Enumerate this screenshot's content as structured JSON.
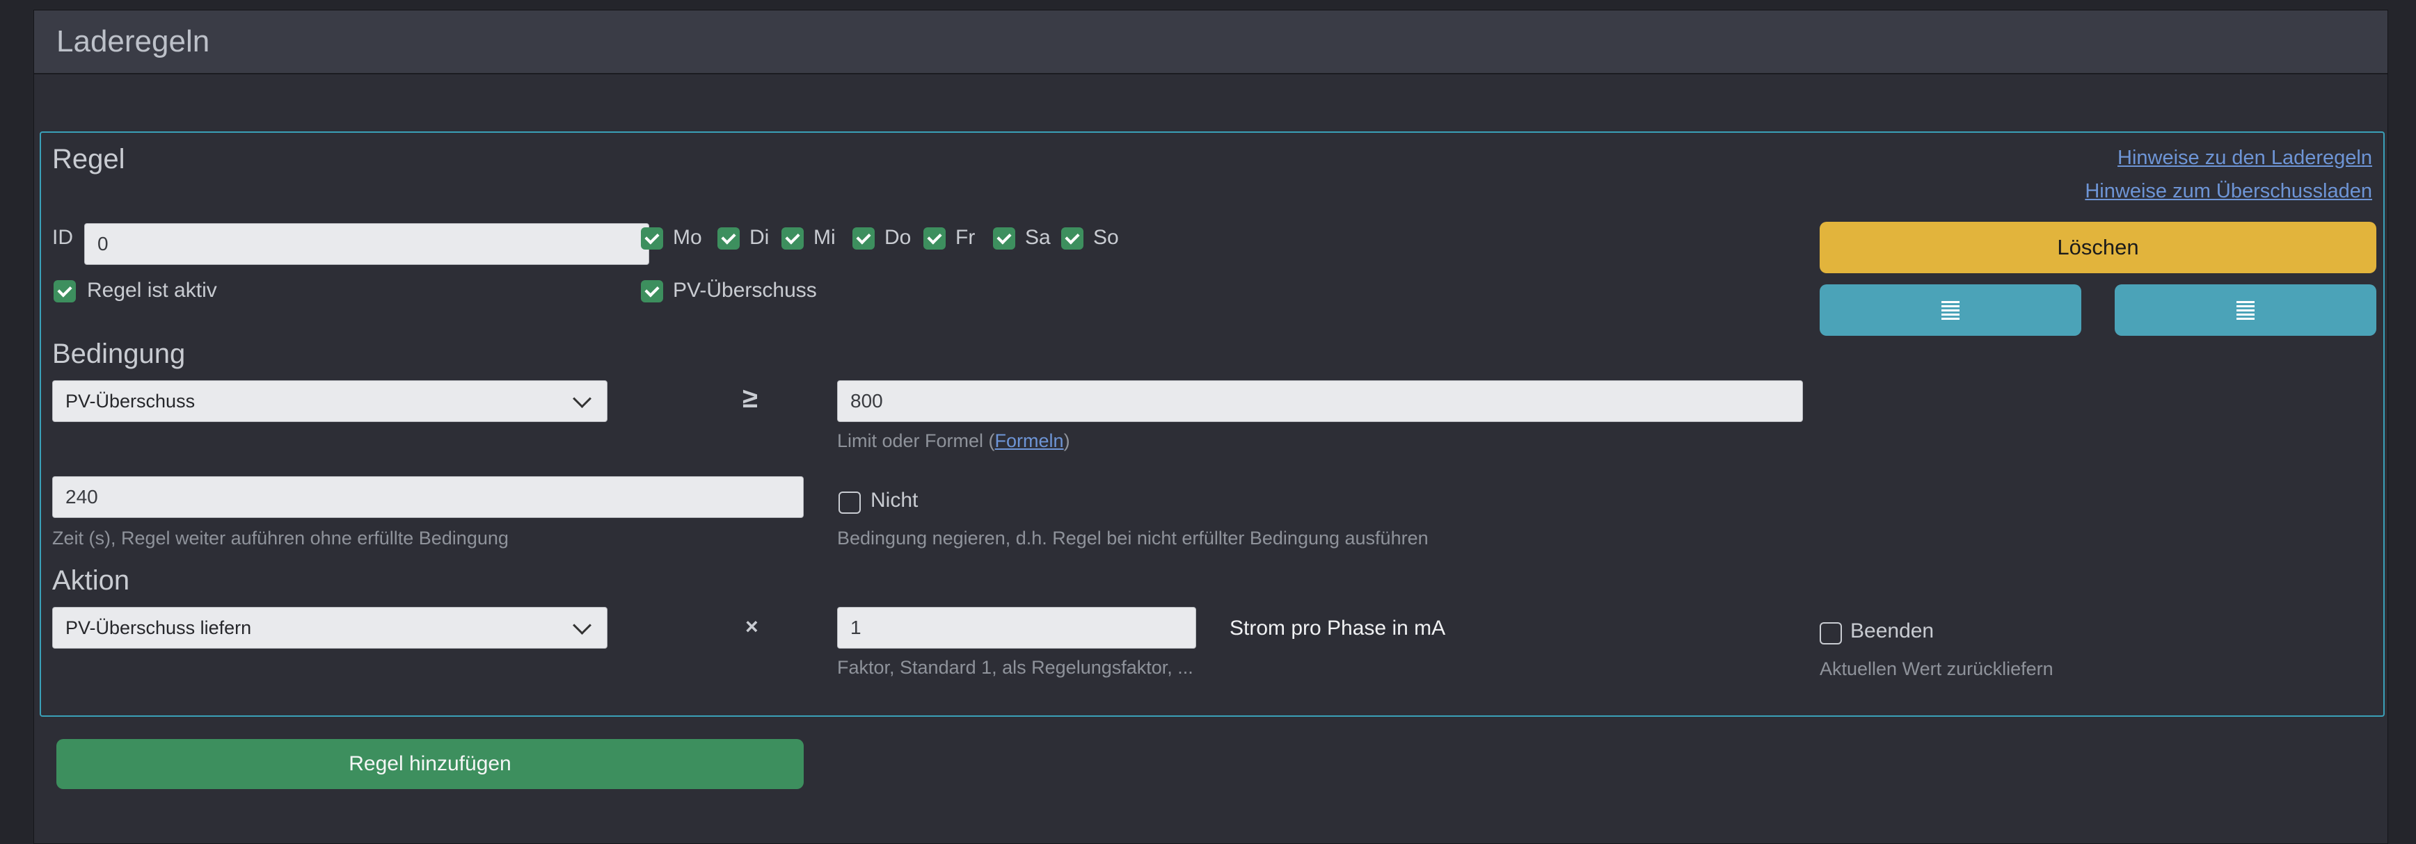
{
  "page": {
    "title": "Laderegeln"
  },
  "rule": {
    "heading": "Regel",
    "links": {
      "laderegeln": "Hinweise zu den Laderegeln",
      "ueberschuss": "Hinweise zum Überschussladen"
    },
    "id_label": "ID",
    "id_value": "0",
    "active_label": "Regel ist aktiv",
    "active_checked": true,
    "days": [
      {
        "label": "Mo",
        "checked": true
      },
      {
        "label": "Di",
        "checked": true
      },
      {
        "label": "Mi",
        "checked": true
      },
      {
        "label": "Do",
        "checked": true
      },
      {
        "label": "Fr",
        "checked": true
      },
      {
        "label": "Sa",
        "checked": true
      },
      {
        "label": "So",
        "checked": true
      }
    ],
    "pv_label": "PV-Überschuss",
    "pv_checked": true,
    "delete_label": "Löschen",
    "move_icon": "menu-lines-icon"
  },
  "condition": {
    "heading": "Bedingung",
    "source_selected": "PV-Überschuss",
    "operator": "≥",
    "limit_value": "800",
    "limit_help_prefix": "Limit oder Formel (",
    "limit_help_link": "Formeln",
    "limit_help_suffix": ")",
    "time_value": "240",
    "time_help": "Zeit (s), Regel weiter auführen ohne erfüllte Bedingung",
    "not_label": "Nicht",
    "not_checked": false,
    "not_help": "Bedingung negieren, d.h. Regel bei nicht erfüllter Bedingung ausführen"
  },
  "action": {
    "heading": "Aktion",
    "action_selected": "PV-Überschuss liefern",
    "operator": "×",
    "factor_value": "1",
    "factor_help": "Faktor, Standard 1, als Regelungsfaktor, ...",
    "unit_label": "Strom pro Phase in mA",
    "end_label": "Beenden",
    "end_checked": false,
    "end_help": "Aktuellen Wert zurückliefern"
  },
  "add_rule_label": "Regel hinzufügen",
  "colors": {
    "accent_border": "#3aa0b8",
    "warning": "#e2b43c",
    "info": "#4ba3b8",
    "success": "#3d8f5e",
    "link": "#6e95d6"
  }
}
